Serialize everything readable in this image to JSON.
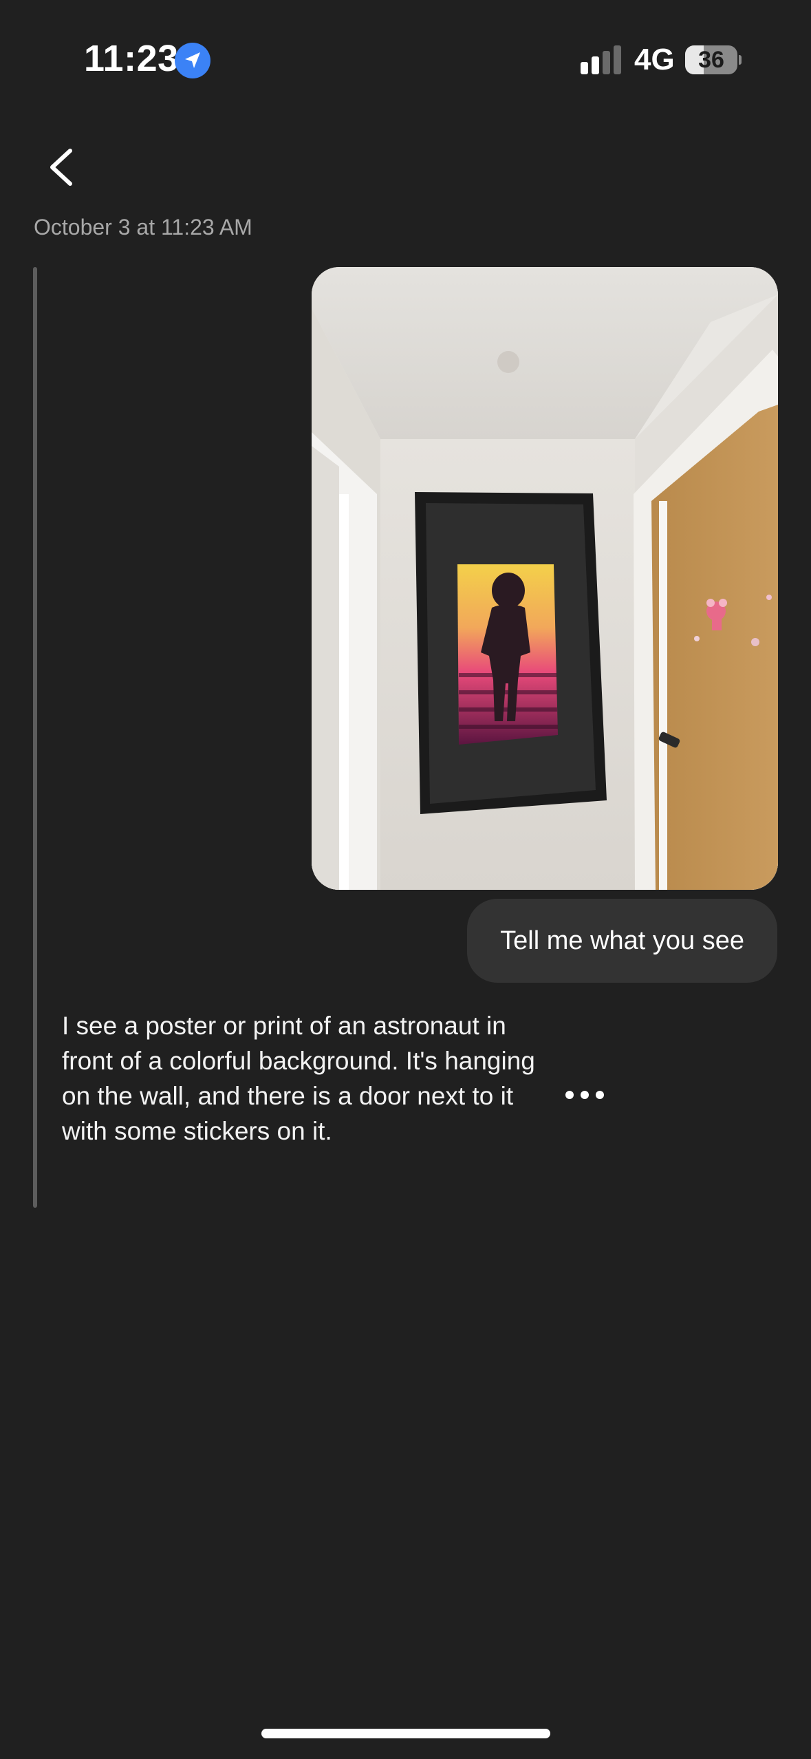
{
  "status_bar": {
    "time": "11:23",
    "network": "4G",
    "battery_level": "36",
    "battery_fraction": 0.36
  },
  "icons": {
    "back": "chevron-left-icon",
    "location": "location-arrow-icon",
    "signal": "cellular-signal-icon",
    "more": "more-horizontal-icon"
  },
  "conversation": {
    "timestamp": "October 3 at 11:23 AM",
    "user_message": "Tell me what you see",
    "ai_response": "I see a poster or print of an astronaut in front of a colorful background. It's hanging on the wall, and there is a door next to it with some stickers on it."
  },
  "colors": {
    "background": "#202020",
    "bubble": "#333333",
    "timestamp": "#a8a8a8",
    "location_accent": "#3b82f6"
  }
}
